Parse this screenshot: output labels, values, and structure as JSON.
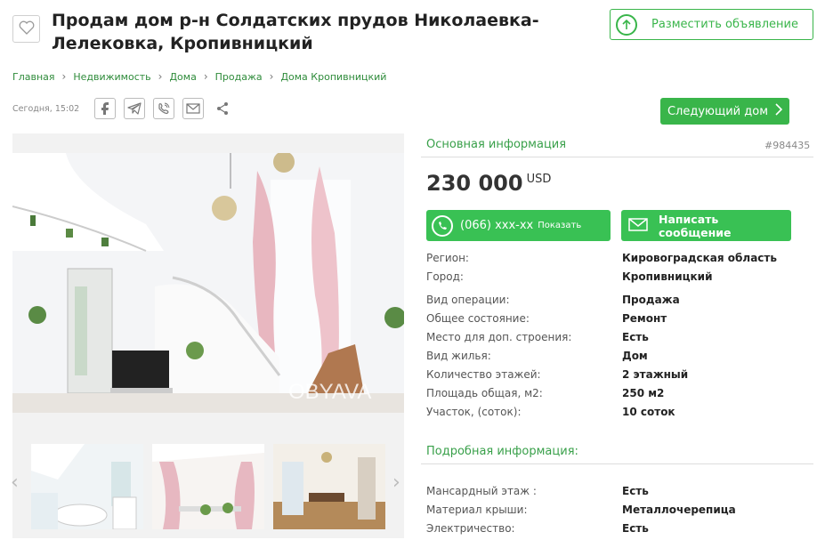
{
  "title": "Продам дом р-н Солдатских прудов Николаевка-Лелековка, Кропивницкий",
  "post_button": "Разместить объявление",
  "breadcrumb": [
    "Главная",
    "Недвижимость",
    "Дома",
    "Продажа",
    "Дома Кропивницкий"
  ],
  "date": "Сегодня, 15:02",
  "next_button": "Следующий дом",
  "photo_watermark": "OBYAVA",
  "main_info_title": "Основная информация",
  "ad_id": "#984435",
  "price": {
    "amount": "230 000",
    "currency": "USD"
  },
  "phone": {
    "number": "(066) xxx-xx",
    "show_label": "Показать"
  },
  "message_button": "Написать сообщение",
  "main_info": [
    {
      "label": "Регион:",
      "value": "Кировоградская область"
    },
    {
      "label": "Город:",
      "value": "Кропивницкий"
    },
    {
      "label": "Вид операции:",
      "value": "Продажа"
    },
    {
      "label": "Общее состояние:",
      "value": "Ремонт"
    },
    {
      "label": "Место для доп. строения:",
      "value": "Есть"
    },
    {
      "label": "Вид жилья:",
      "value": "Дом"
    },
    {
      "label": "Количество этажей:",
      "value": "2 этажный"
    },
    {
      "label": "Площадь общая, м2:",
      "value": "250 м2"
    },
    {
      "label": "Участок, (соток):",
      "value": "10 соток"
    }
  ],
  "detail_title": "Подробная информация:",
  "detail_info": [
    {
      "label": "Мансардный этаж :",
      "value": "Есть"
    },
    {
      "label": "Материал крыши:",
      "value": "Металлочерепица"
    },
    {
      "label": "Электричество:",
      "value": "Есть"
    }
  ],
  "colors": {
    "accent": "#39b54a",
    "button": "#39c154",
    "link": "#2e8b3a"
  },
  "icons": [
    "heart-icon",
    "arrow-up-circle-icon",
    "chevron-right-icon",
    "facebook-icon",
    "telegram-icon",
    "viber-icon",
    "mail-icon",
    "share-icon",
    "phone-icon",
    "envelope-icon",
    "chevron-left-icon"
  ]
}
